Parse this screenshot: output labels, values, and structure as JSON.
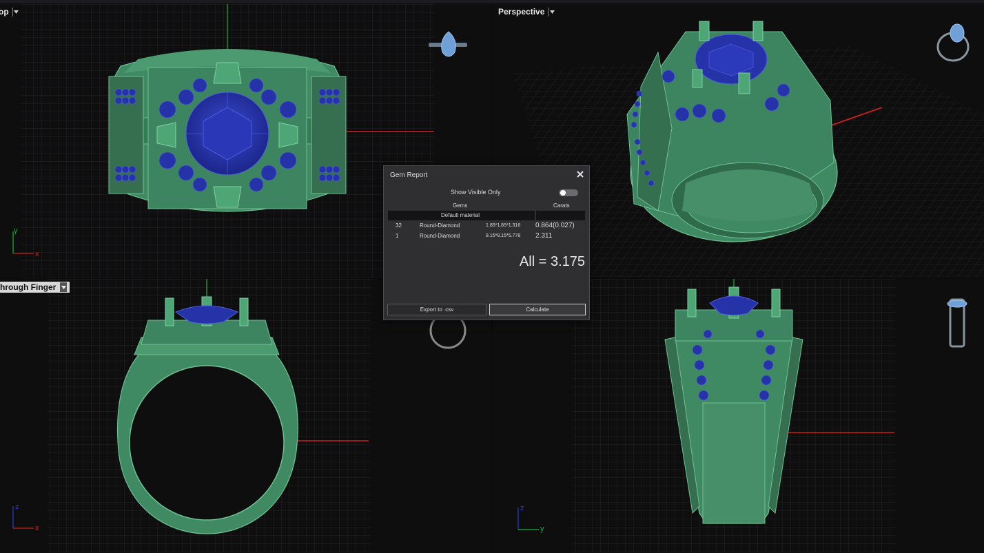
{
  "viewports": {
    "top": {
      "title": "op"
    },
    "perspective": {
      "title": "Perspective"
    },
    "front": {
      "title": "hrough Finger"
    },
    "right": {
      "title": ""
    }
  },
  "axes": {
    "x": "x",
    "y": "y",
    "z": "z"
  },
  "gem_report": {
    "title": "Gem Report",
    "show_visible_only_label": "Show Visible Only",
    "show_visible_only": false,
    "columns": {
      "gems": "Gems",
      "carats": "Carats"
    },
    "material": "Default material",
    "rows": [
      {
        "count": "32",
        "name": "Round-Diamond",
        "dims": "1.85*1.85*1.316",
        "carats": "0.864(0.027)"
      },
      {
        "count": "1",
        "name": "Round-Diamond",
        "dims": "8.15*8.15*5.778",
        "carats": "2.311"
      }
    ],
    "total": "All = 3.175",
    "export_label": "Export to .csv",
    "calculate_label": "Calculate"
  },
  "colors": {
    "metal": "#3f8a62",
    "gem": "#2633a8",
    "axis_x": "#d01e1e",
    "axis_y": "#1cb33a",
    "axis_z": "#2a3ccf",
    "grid": "#242426"
  }
}
